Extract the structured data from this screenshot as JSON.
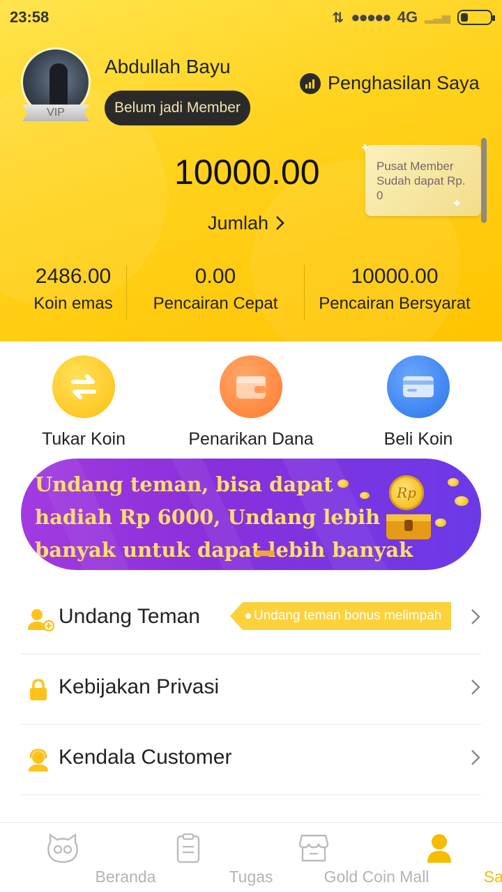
{
  "status_bar": {
    "time": "23:58",
    "network": "4G"
  },
  "profile": {
    "name": "Abdullah Bayu",
    "vip_label": "VIP",
    "member_status": "Belum jadi Member",
    "earnings_link": "Penghasilan Saya"
  },
  "balance": {
    "amount": "10000.00",
    "label": "Jumlah"
  },
  "member_center": {
    "line1": "Pusat Member",
    "line2": "Sudah dapat Rp.",
    "line3": "0"
  },
  "stats": [
    {
      "value": "2486.00",
      "label": "Koin emas"
    },
    {
      "value": "0.00",
      "label": "Pencairan Cepat"
    },
    {
      "value": "10000.00",
      "label": "Pencairan Bersyarat"
    }
  ],
  "actions": [
    {
      "label": "Tukar Koin",
      "icon": "exchange-icon",
      "color": "#ffc81e"
    },
    {
      "label": "Penarikan Dana",
      "icon": "wallet-icon",
      "color": "#ff8a3c"
    },
    {
      "label": "Beli Koin",
      "icon": "card-icon",
      "color": "#3a86f0"
    }
  ],
  "banner": {
    "line1": "Undang teman, bisa dapat",
    "line2": "hadiah Rp 6000, Undang lebih",
    "line3": "banyak untuk dapat lebih banyak hadiah",
    "coin_label": "Rp"
  },
  "menu": [
    {
      "label": "Undang Teman",
      "icon": "invite-user-icon",
      "tag": "Undang teman bonus melimpah"
    },
    {
      "label": "Kebijakan Privasi",
      "icon": "lock-icon"
    },
    {
      "label": "Kendala Customer",
      "icon": "customer-service-icon"
    }
  ],
  "bottom_nav": [
    {
      "label": "Beranda",
      "icon": "cat-face-icon",
      "active": false
    },
    {
      "label": "Tugas",
      "icon": "clipboard-icon",
      "active": false
    },
    {
      "label": "Gold Coin Mall",
      "icon": "store-icon",
      "active": false
    },
    {
      "label": "Saya",
      "icon": "person-icon",
      "active": true
    }
  ],
  "colors": {
    "accent": "#ffd21c",
    "active_nav": "#f5bc00",
    "banner": "#8b2fdc"
  }
}
